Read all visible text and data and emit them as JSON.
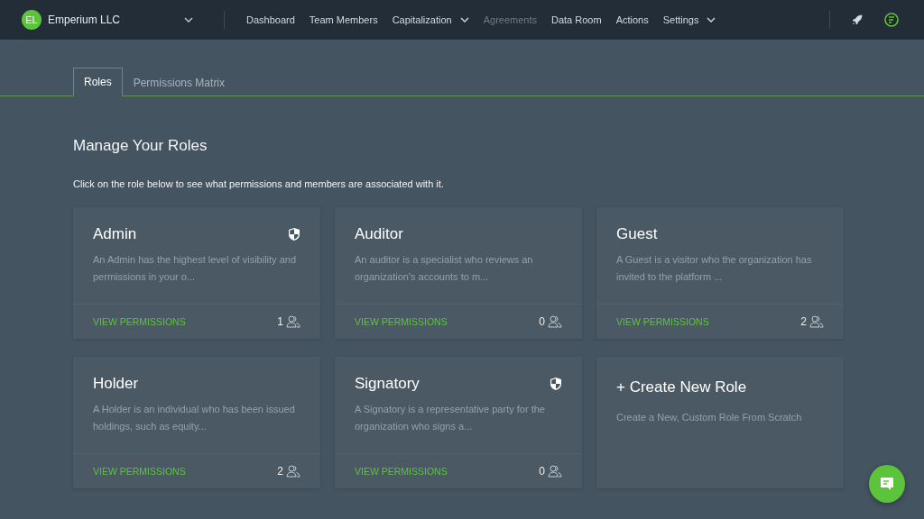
{
  "company": {
    "initials": "EL",
    "name": "Emperium LLC"
  },
  "nav": [
    {
      "label": "Dashboard",
      "has_menu": false,
      "disabled": false
    },
    {
      "label": "Team Members",
      "has_menu": false,
      "disabled": false
    },
    {
      "label": "Capitalization",
      "has_menu": true,
      "disabled": false
    },
    {
      "label": "Agreements",
      "has_menu": false,
      "disabled": true
    },
    {
      "label": "Data Room",
      "has_menu": false,
      "disabled": false
    },
    {
      "label": "Actions",
      "has_menu": false,
      "disabled": false
    },
    {
      "label": "Settings",
      "has_menu": true,
      "disabled": false
    }
  ],
  "tabs": [
    {
      "label": "Roles",
      "selected": true
    },
    {
      "label": "Permissions Matrix",
      "selected": false
    }
  ],
  "heading": "Manage Your Roles",
  "intro": "Click on the role below to see what permissions and members are associated with it.",
  "roles": [
    {
      "name": "Admin",
      "description": "An Admin has the highest level of visibility and permissions in your o...",
      "link": "VIEW PERMISSIONS",
      "members": "1",
      "protected": true
    },
    {
      "name": "Auditor",
      "description": "An auditor is a specialist who reviews an organization's accounts to m...",
      "link": "VIEW PERMISSIONS",
      "members": "0",
      "protected": false
    },
    {
      "name": "Guest",
      "description": "A Guest is a visitor who the organization has invited to the platform ...",
      "link": "VIEW PERMISSIONS",
      "members": "2",
      "protected": false
    },
    {
      "name": "Holder",
      "description": "A Holder is an individual who has been issued holdings, such as equity...",
      "link": "VIEW PERMISSIONS",
      "members": "2",
      "protected": false
    },
    {
      "name": "Signatory",
      "description": "A Signatory is a representative party for the organization who signs a...",
      "link": "VIEW PERMISSIONS",
      "members": "0",
      "protected": true
    }
  ],
  "create_role": {
    "title": "+ Create New Role",
    "subtitle": "Create a New, Custom Role From Scratch"
  }
}
